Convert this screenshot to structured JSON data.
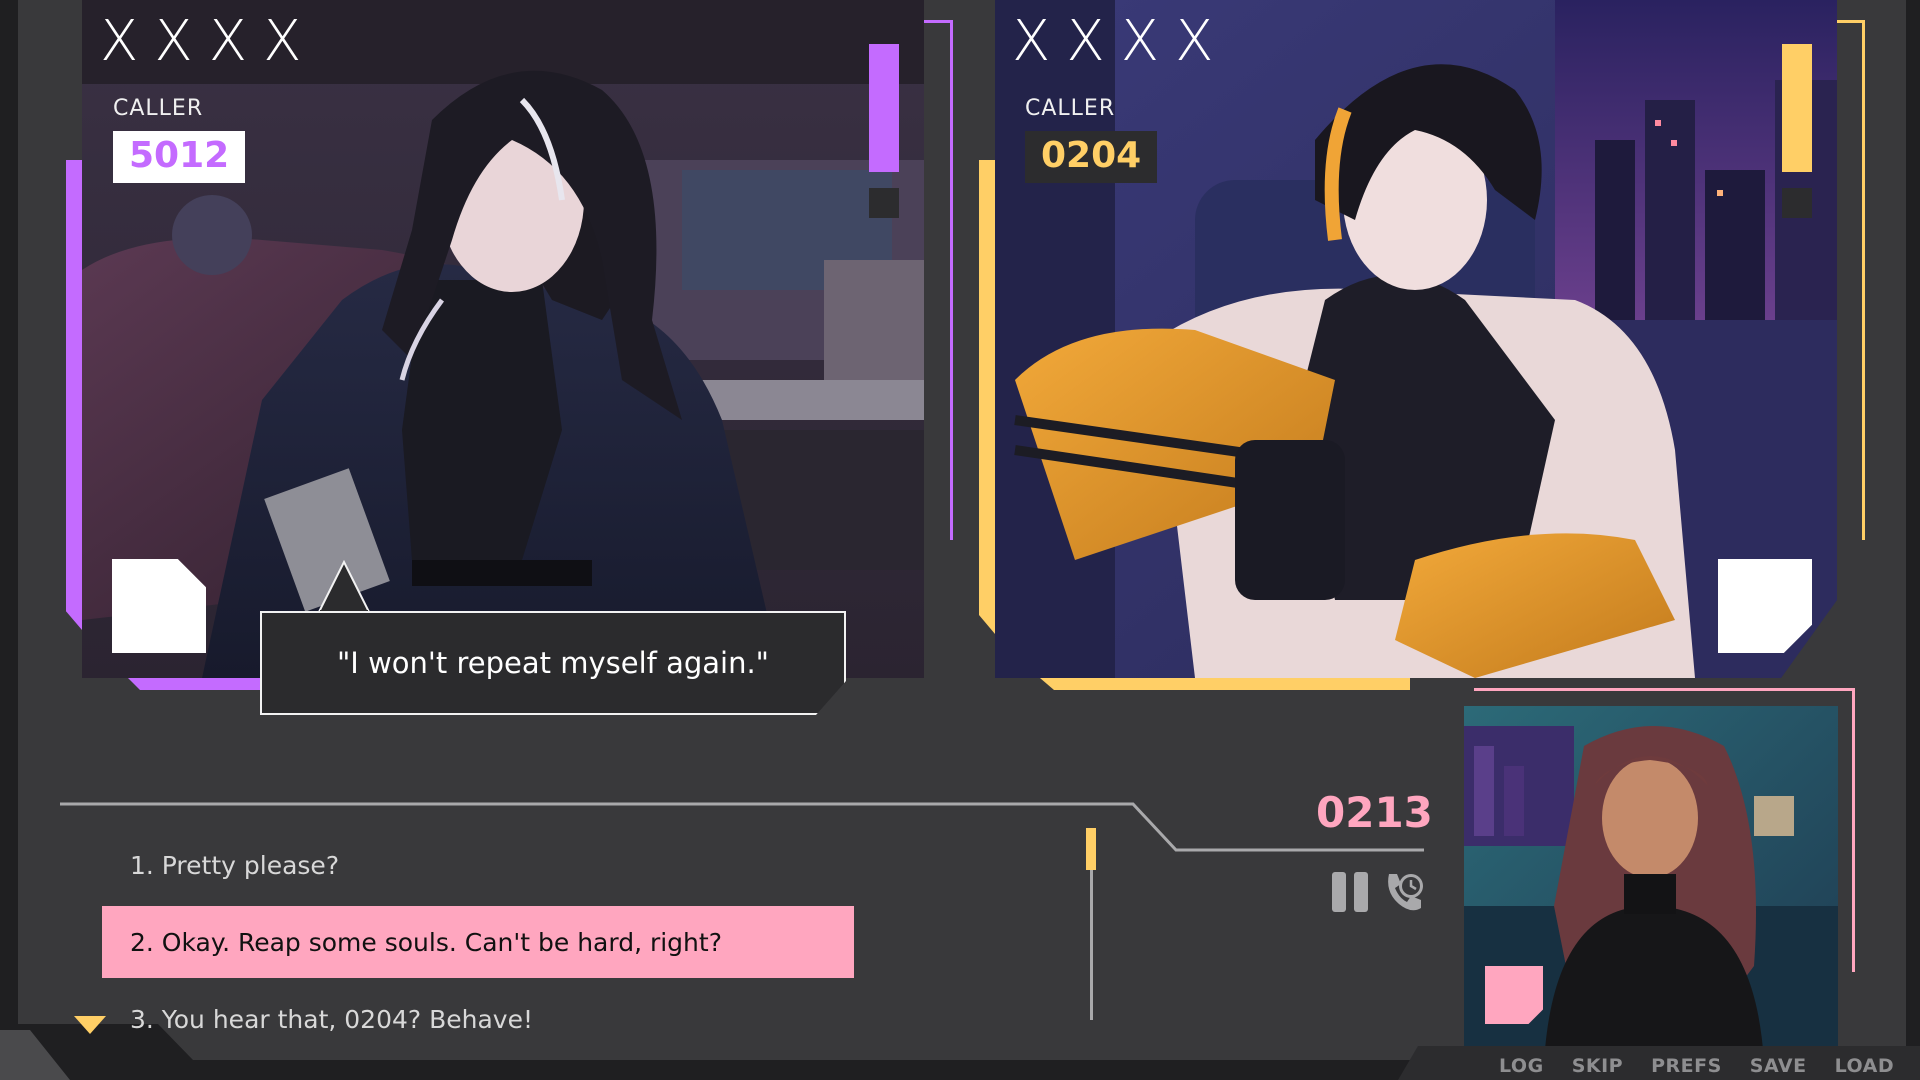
{
  "callers": [
    {
      "marks": "XXXX",
      "label": "CALLER",
      "id": "5012",
      "accent_color": "#c46bff"
    },
    {
      "marks": "XXXX",
      "label": "CALLER",
      "id": "0204",
      "accent_color": "#ffcf66"
    },
    {
      "id": "0213",
      "accent_color": "#ffa6bf"
    }
  ],
  "dialogue": {
    "line": "\"I won't repeat myself again.\""
  },
  "choices": [
    {
      "label": "1. Pretty please?",
      "selected": false
    },
    {
      "label": "2. Okay. Reap some souls. Can't be hard, right?",
      "selected": true
    },
    {
      "label": "3. You hear that, 0204? Behave!",
      "selected": false
    }
  ],
  "call_controls": {
    "pause_icon": "pause-icon",
    "call_icon": "phone-clock-icon"
  },
  "quick_menu": [
    "LOG",
    "SKIP",
    "PREFS",
    "SAVE",
    "LOAD"
  ]
}
